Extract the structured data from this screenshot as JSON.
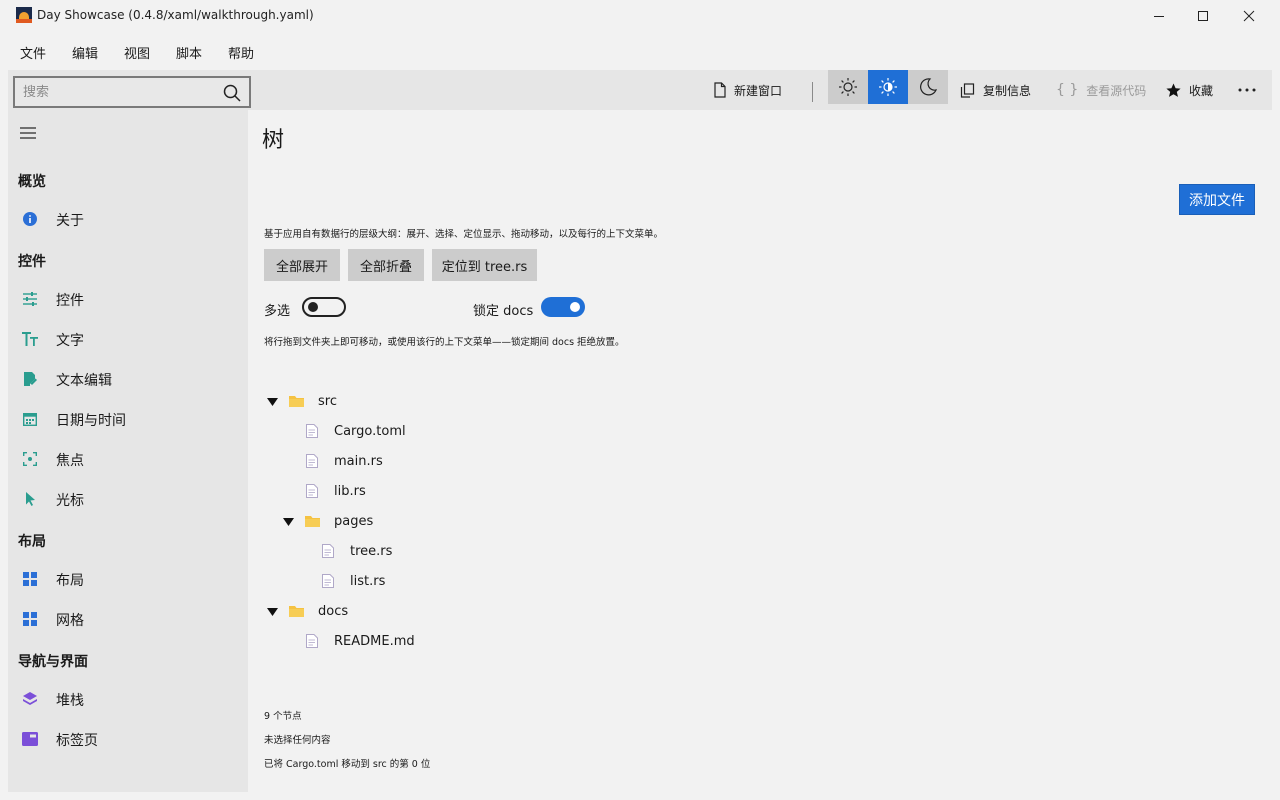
{
  "window": {
    "title": "Day Showcase (0.4.8/xaml/walkthrough.yaml)"
  },
  "menu": [
    "文件",
    "编辑",
    "视图",
    "脚本",
    "帮助"
  ],
  "toolbar": {
    "search_placeholder": "搜索",
    "new_window": "新建窗口",
    "copy_info": "复制信息",
    "view_source": "查看源代码",
    "favorite": "收藏"
  },
  "sidebar": {
    "sections": [
      {
        "heading": "概览",
        "items": [
          {
            "label": "关于",
            "icon": "info-icon"
          }
        ]
      },
      {
        "heading": "控件",
        "items": [
          {
            "label": "控件",
            "icon": "sliders-icon"
          },
          {
            "label": "文字",
            "icon": "text-size-icon"
          },
          {
            "label": "文本编辑",
            "icon": "edit-document-icon"
          },
          {
            "label": "日期与时间",
            "icon": "calendar-icon"
          },
          {
            "label": "焦点",
            "icon": "focus-icon"
          },
          {
            "label": "光标",
            "icon": "cursor-icon"
          }
        ]
      },
      {
        "heading": "布局",
        "items": [
          {
            "label": "布局",
            "icon": "layout-grid-icon"
          },
          {
            "label": "网格",
            "icon": "grid-icon"
          }
        ]
      },
      {
        "heading": "导航与界面",
        "items": [
          {
            "label": "堆栈",
            "icon": "layers-icon"
          },
          {
            "label": "标签页",
            "icon": "tab-icon"
          }
        ]
      }
    ]
  },
  "page": {
    "title": "树",
    "add_file": "添加文件",
    "description": "基于应用自有数据行的层级大纲：展开、选择、定位显示、拖动移动，以及每行的上下文菜单。",
    "expand_all": "全部展开",
    "collapse_all": "全部折叠",
    "locate": "定位到 tree.rs",
    "multi_select_label": "多选",
    "multi_select_on": false,
    "lock_label": "锁定 docs",
    "lock_on": true,
    "hint": "将行拖到文件夹上即可移动，或使用该行的上下文菜单——锁定期间 docs 拒绝放置。"
  },
  "tree": [
    {
      "label": "src",
      "type": "folder",
      "depth": 0,
      "expanded": true
    },
    {
      "label": "Cargo.toml",
      "type": "file",
      "depth": 1
    },
    {
      "label": "main.rs",
      "type": "file",
      "depth": 1
    },
    {
      "label": "lib.rs",
      "type": "file",
      "depth": 1
    },
    {
      "label": "pages",
      "type": "folder",
      "depth": 1,
      "expanded": true
    },
    {
      "label": "tree.rs",
      "type": "file",
      "depth": 2
    },
    {
      "label": "list.rs",
      "type": "file",
      "depth": 2
    },
    {
      "label": "docs",
      "type": "folder",
      "depth": 0,
      "expanded": true
    },
    {
      "label": "README.md",
      "type": "file",
      "depth": 1
    }
  ],
  "status": {
    "node_count": "9 个节点",
    "selection": "未选择任何内容",
    "last_action": "已将 Cargo.toml 移动到 src 的第 0 位"
  },
  "colors": {
    "accent": "#1f6fd6",
    "folder": "#f5c242",
    "sidebar_bg": "#e6e6e6",
    "teal_icon": "#2a9d8f",
    "blue_icon": "#2b6fd6",
    "purple_icon": "#7b4fd8"
  }
}
